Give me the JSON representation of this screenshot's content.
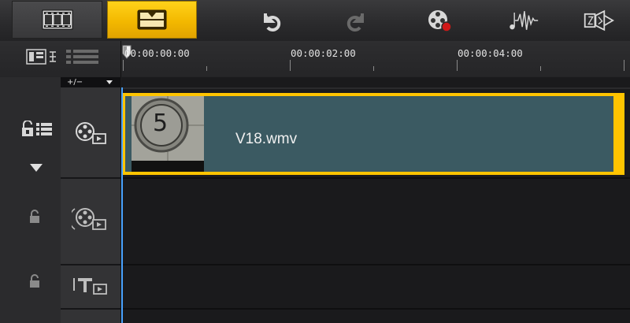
{
  "toolbar": {
    "buttons": [
      {
        "name": "storyboard-view",
        "icon": "film-strip-icon"
      },
      {
        "name": "timeline-view",
        "icon": "timeline-icon",
        "active": true
      },
      {
        "name": "undo",
        "icon": "undo-icon"
      },
      {
        "name": "redo",
        "icon": "redo-icon",
        "disabled": true
      },
      {
        "name": "record-capture",
        "icon": "record-capture-icon"
      },
      {
        "name": "sound-mixer",
        "icon": "audio-wave-icon"
      },
      {
        "name": "auto-music",
        "icon": "transition-icon"
      }
    ]
  },
  "ruler": {
    "timecodes": [
      "00:00:00:00",
      "00:00:02:00",
      "00:00:04:00"
    ],
    "zoom_label": "+/−"
  },
  "tracks": [
    {
      "type": "video",
      "icon": "video-track-icon",
      "lock_icon": "lock-all-icon",
      "expanded": true
    },
    {
      "type": "overlay",
      "icon": "overlay-track-icon",
      "lock_icon": "lock-icon"
    },
    {
      "type": "title",
      "icon": "title-track-icon",
      "lock_icon": "lock-icon"
    }
  ],
  "clip": {
    "name": "V18.wmv",
    "thumbnail_countdown": "5",
    "highlight_color": "#ffc400",
    "body_color": "#3b5a62"
  },
  "colors": {
    "accent": "#f3b800",
    "playhead": "#4aa3ff",
    "background": "#1b1b1d"
  }
}
